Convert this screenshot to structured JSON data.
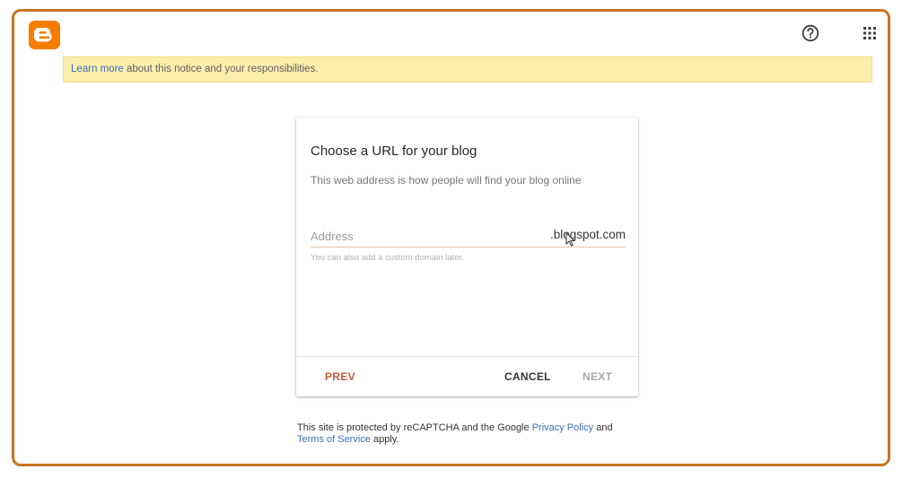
{
  "header": {
    "logo_letter": "B",
    "brand_color": "#f57d00",
    "help_icon": "help-circle-icon",
    "apps_icon": "apps-grid-icon"
  },
  "notice": {
    "link_text": "Learn more",
    "text": " about this notice and your responsibilities."
  },
  "card": {
    "title": "Choose a URL for your blog",
    "subtitle": "This web address is how people will find your blog online",
    "address": {
      "value": "",
      "placeholder": "Address",
      "suffix": ".blogspot.com"
    },
    "helper": "You can also add a custom domain later.",
    "buttons": {
      "prev": "PREV",
      "cancel": "CANCEL",
      "next": "NEXT"
    }
  },
  "footer": {
    "text_1": "This site is protected by reCAPTCHA and the Google ",
    "privacy_link": "Privacy Policy",
    "text_2": " and ",
    "terms_link": "Terms of Service",
    "text_3": " apply."
  },
  "colors": {
    "accent_orange": "#c8741f",
    "prev_button": "#c65b3c",
    "link_blue": "#3b6fb6",
    "notice_bg": "#fcefae"
  }
}
